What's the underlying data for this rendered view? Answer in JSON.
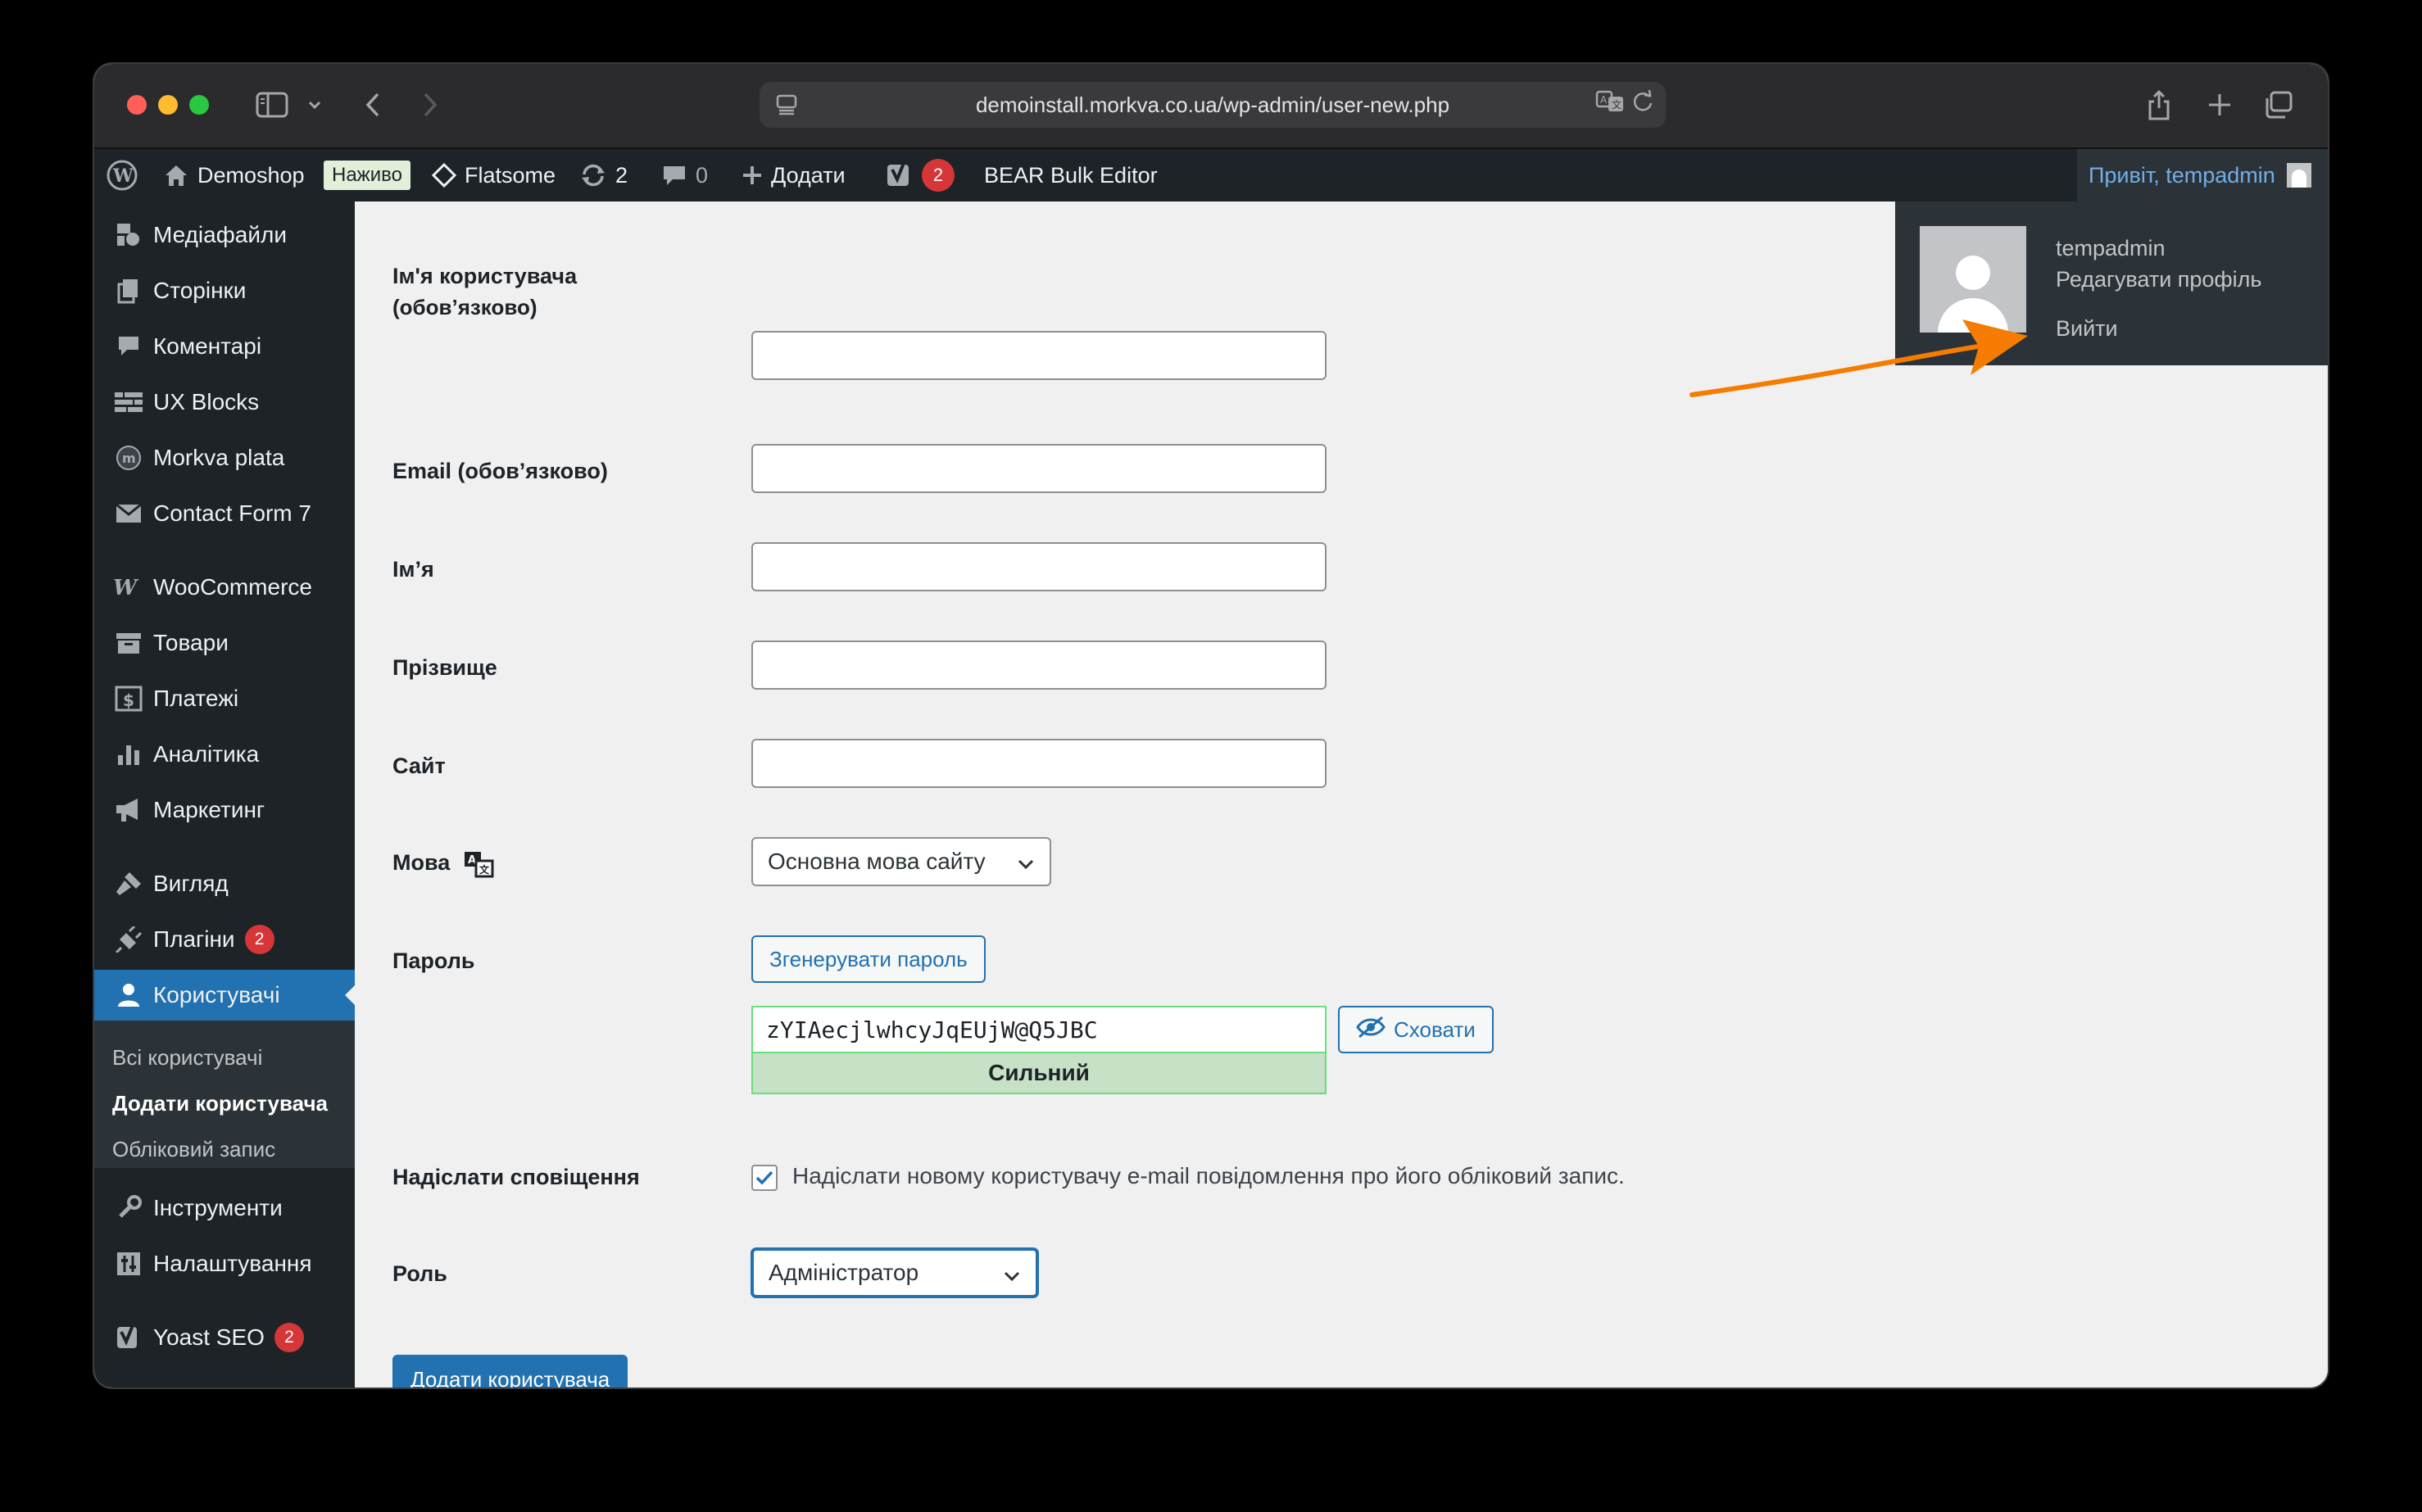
{
  "browser": {
    "url": "demoinstall.morkva.co.ua/wp-admin/user-new.php"
  },
  "adminbar": {
    "site_name": "Demoshop",
    "live_badge": "Наживо",
    "theme": "Flatsome",
    "updates_count": "2",
    "comments_count": "0",
    "add_new": "Додати",
    "yoast_count": "2",
    "bear": "BEAR Bulk Editor",
    "howdy": "Привіт, tempadmin"
  },
  "user_dropdown": {
    "username": "tempadmin",
    "edit_profile": "Редагувати профіль",
    "logout": "Вийти"
  },
  "sidebar": {
    "items": [
      {
        "label": "Медіафайли",
        "icon": "media-icon"
      },
      {
        "label": "Сторінки",
        "icon": "pages-icon"
      },
      {
        "label": "Коментарі",
        "icon": "comments-icon"
      },
      {
        "label": "UX Blocks",
        "icon": "ux-blocks-icon"
      },
      {
        "label": "Morkva plata",
        "icon": "morkva-icon"
      },
      {
        "label": "Contact Form 7",
        "icon": "mail-icon"
      },
      {
        "label": "WooCommerce",
        "icon": "woocommerce-icon"
      },
      {
        "label": "Товари",
        "icon": "products-icon"
      },
      {
        "label": "Платежі",
        "icon": "payments-icon"
      },
      {
        "label": "Аналітика",
        "icon": "analytics-icon"
      },
      {
        "label": "Маркетинг",
        "icon": "megaphone-icon"
      },
      {
        "label": "Вигляд",
        "icon": "appearance-icon"
      },
      {
        "label": "Плагіни",
        "icon": "plugins-icon",
        "badge": "2"
      },
      {
        "label": "Користувачі",
        "icon": "users-icon"
      },
      {
        "label": "Інструменти",
        "icon": "tools-icon"
      },
      {
        "label": "Налаштування",
        "icon": "settings-icon"
      },
      {
        "label": "Yoast SEO",
        "icon": "yoast-icon",
        "badge": "2"
      }
    ],
    "submenu": [
      "Всі користувачі",
      "Додати користувача",
      "Обліковий запис"
    ]
  },
  "form": {
    "username_label": "Ім'я користувача",
    "username_required": "(обов’язково)",
    "email_label": "Email (обов’язково)",
    "first_name_label": "Ім’я",
    "last_name_label": "Прізвище",
    "site_label": "Сайт",
    "language_label": "Мова",
    "language_value": "Основна мова сайту",
    "password_label": "Пароль",
    "generate_password": "Згенерувати пароль",
    "password_value": "zYIAecjlwhcyJqEUjW@Q5JBC",
    "hide_button": "Сховати",
    "strength": "Сильний",
    "notify_label": "Надіслати сповіщення",
    "notify_text": "Надіслати новому користувачу e-mail повідомлення про його обліковий запис.",
    "role_label": "Роль",
    "role_value": "Адміністратор",
    "submit": "Додати користувача"
  },
  "colors": {
    "wp_dark": "#1d2327",
    "wp_blue": "#2271b1",
    "arrow": "#f57c00",
    "badge_red": "#d63638"
  }
}
